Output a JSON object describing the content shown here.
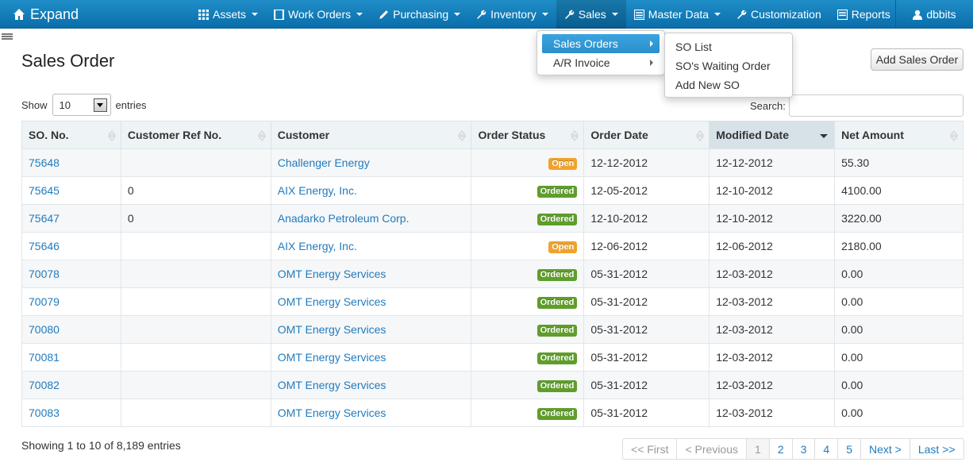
{
  "navbar": {
    "brand": "Expand",
    "items": [
      {
        "label": "Assets",
        "icon": "grid-icon",
        "caret": true
      },
      {
        "label": "Work Orders",
        "icon": "document-icon",
        "caret": true
      },
      {
        "label": "Purchasing",
        "icon": "pencil-icon",
        "caret": true
      },
      {
        "label": "Inventory",
        "icon": "wrench-icon",
        "caret": true
      },
      {
        "label": "Sales",
        "icon": "wrench-icon",
        "caret": true
      },
      {
        "label": "Master Data",
        "icon": "list-icon",
        "caret": true
      },
      {
        "label": "Customization",
        "icon": "wrench-icon",
        "caret": false
      },
      {
        "label": "Reports",
        "icon": "report-icon",
        "caret": false
      }
    ],
    "user": "dbbits"
  },
  "sales_menu": {
    "items": [
      "Sales Orders",
      "A/R Invoice"
    ],
    "submenu": [
      "SO List",
      "SO's Waiting Order",
      "Add New SO"
    ]
  },
  "page": {
    "title": "Sales Order",
    "add_button": "Add Sales Order",
    "show_label": "Show",
    "show_value": "10",
    "entries_label": "entries",
    "search_label": "Search:"
  },
  "table": {
    "columns": [
      "SO. No.",
      "Customer Ref No.",
      "Customer",
      "Order Status",
      "Order Date",
      "Modified Date",
      "Net Amount"
    ],
    "rows": [
      {
        "so": "75648",
        "ref": "",
        "customer": "Challenger Energy",
        "status": "Open",
        "order_date": "12-12-2012",
        "modified": "12-12-2012",
        "amount": "55.30"
      },
      {
        "so": "75645",
        "ref": "0",
        "customer": "AIX Energy, Inc.",
        "status": "Ordered",
        "order_date": "12-05-2012",
        "modified": "12-10-2012",
        "amount": "4100.00"
      },
      {
        "so": "75647",
        "ref": "0",
        "customer": "Anadarko Petroleum Corp.",
        "status": "Ordered",
        "order_date": "12-10-2012",
        "modified": "12-10-2012",
        "amount": "3220.00"
      },
      {
        "so": "75646",
        "ref": "",
        "customer": "AIX Energy, Inc.",
        "status": "Open",
        "order_date": "12-06-2012",
        "modified": "12-06-2012",
        "amount": "2180.00"
      },
      {
        "so": "70078",
        "ref": "",
        "customer": "OMT Energy Services",
        "status": "Ordered",
        "order_date": "05-31-2012",
        "modified": "12-03-2012",
        "amount": "0.00"
      },
      {
        "so": "70079",
        "ref": "",
        "customer": "OMT Energy Services",
        "status": "Ordered",
        "order_date": "05-31-2012",
        "modified": "12-03-2012",
        "amount": "0.00"
      },
      {
        "so": "70080",
        "ref": "",
        "customer": "OMT Energy Services",
        "status": "Ordered",
        "order_date": "05-31-2012",
        "modified": "12-03-2012",
        "amount": "0.00"
      },
      {
        "so": "70081",
        "ref": "",
        "customer": "OMT Energy Services",
        "status": "Ordered",
        "order_date": "05-31-2012",
        "modified": "12-03-2012",
        "amount": "0.00"
      },
      {
        "so": "70082",
        "ref": "",
        "customer": "OMT Energy Services",
        "status": "Ordered",
        "order_date": "05-31-2012",
        "modified": "12-03-2012",
        "amount": "0.00"
      },
      {
        "so": "70083",
        "ref": "",
        "customer": "OMT Energy Services",
        "status": "Ordered",
        "order_date": "05-31-2012",
        "modified": "12-03-2012",
        "amount": "0.00"
      }
    ]
  },
  "footer": {
    "info": "Showing 1 to 10 of 8,189 entries",
    "pager": [
      "<< First",
      "< Previous",
      "1",
      "2",
      "3",
      "4",
      "5",
      "Next >",
      "Last >>"
    ]
  },
  "colors": {
    "navbar": "#0a6eab",
    "link": "#1f7bbf",
    "open_badge": "#f0a32c",
    "ordered_badge": "#5f9e2b"
  }
}
